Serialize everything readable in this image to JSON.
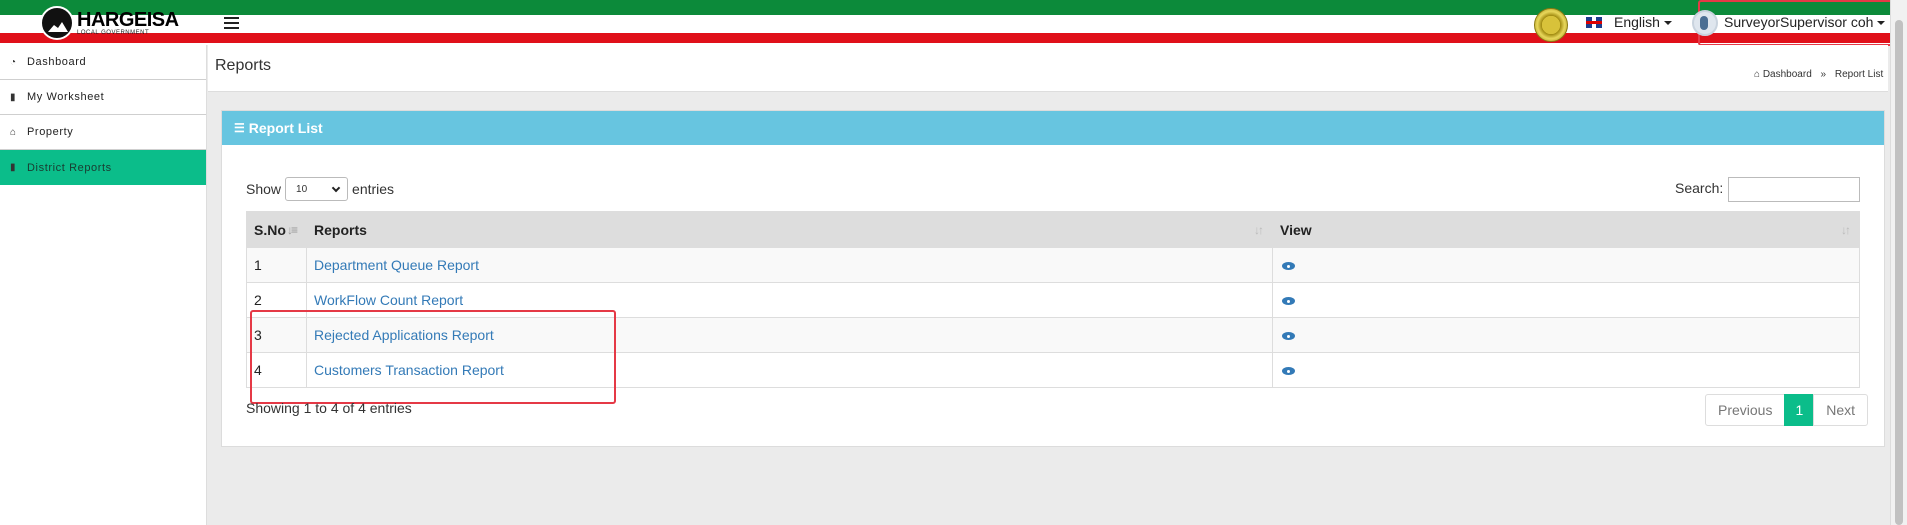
{
  "header": {
    "logo_title": "HARGEISA",
    "logo_subtitle": "LOCAL GOVERNMENT",
    "language": "English",
    "user_name": "SurveyorSupervisor coh",
    "colors": {
      "green": "#0c8a3a",
      "red": "#e0101a"
    }
  },
  "sidebar": {
    "items": [
      {
        "label": "Dashboard",
        "icon": "dashboard-icon"
      },
      {
        "label": "My Worksheet",
        "icon": "worksheet-icon"
      },
      {
        "label": "Property",
        "icon": "home-icon"
      },
      {
        "label": "District Reports",
        "icon": "report-icon",
        "active": true
      }
    ],
    "active_color": "#0bbd8a"
  },
  "page": {
    "title": "Reports",
    "breadcrumb": [
      "Dashboard",
      "Report List"
    ]
  },
  "panel": {
    "title": "Report List",
    "header_color": "#67c5e0",
    "show_label": "Show",
    "entries_value": "10",
    "entries_label": "entries",
    "search_label": "Search:",
    "search_value": ""
  },
  "table": {
    "columns": [
      "S.No",
      "Reports",
      "View"
    ],
    "rows": [
      {
        "sno": "1",
        "report": "Department Queue Report",
        "view": "eye-icon"
      },
      {
        "sno": "2",
        "report": "WorkFlow Count Report",
        "view": "eye-icon"
      },
      {
        "sno": "3",
        "report": "Rejected Applications Report",
        "view": "eye-icon"
      },
      {
        "sno": "4",
        "report": "Customers Transaction Report",
        "view": "eye-icon"
      }
    ]
  },
  "footer": {
    "info": "Showing 1 to 4 of 4 entries",
    "previous": "Previous",
    "current_page": "1",
    "next": "Next"
  }
}
